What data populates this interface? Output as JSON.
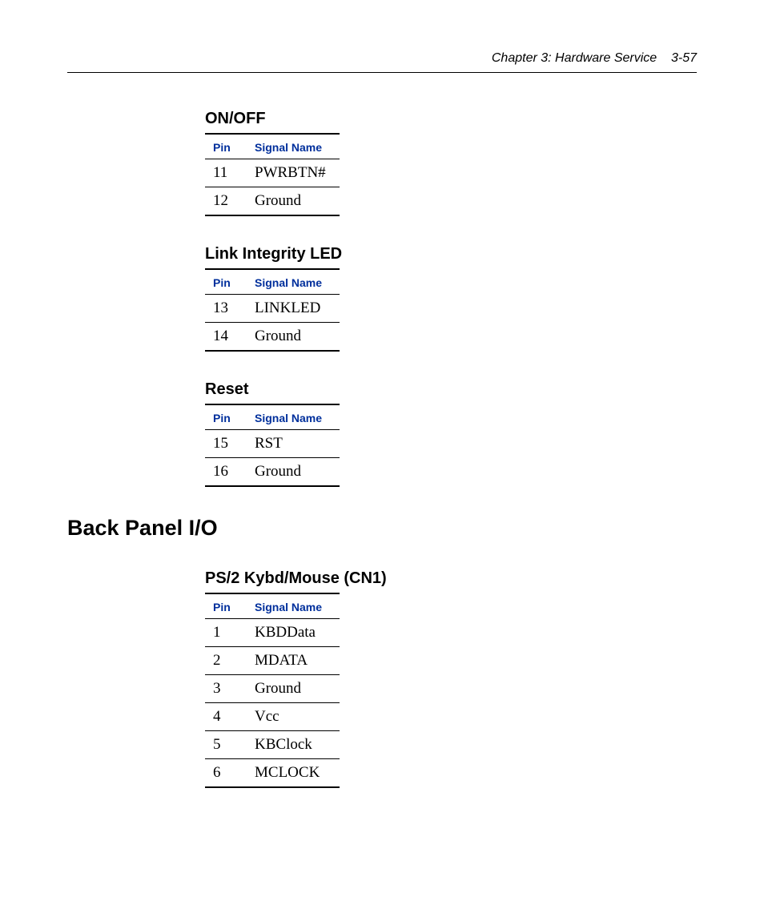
{
  "header": {
    "chapter": "Chapter 3:  Hardware Service",
    "page": "3-57"
  },
  "columns": {
    "pin": "Pin",
    "signal": "Signal Name"
  },
  "tables": [
    {
      "title": "ON/OFF",
      "rows": [
        {
          "pin": "11",
          "signal": "PWRBTN#"
        },
        {
          "pin": "12",
          "signal": "Ground"
        }
      ]
    },
    {
      "title": "Link Integrity LED",
      "rows": [
        {
          "pin": "13",
          "signal": "LINKLED"
        },
        {
          "pin": "14",
          "signal": "Ground"
        }
      ]
    },
    {
      "title": "Reset",
      "rows": [
        {
          "pin": "15",
          "signal": "RST"
        },
        {
          "pin": "16",
          "signal": "Ground"
        }
      ]
    }
  ],
  "section": {
    "title": "Back Panel I/O"
  },
  "tables2": [
    {
      "title": "PS/2 Kybd/Mouse (CN1)",
      "rows": [
        {
          "pin": "1",
          "signal": "KBDData"
        },
        {
          "pin": "2",
          "signal": "MDATA"
        },
        {
          "pin": "3",
          "signal": "Ground"
        },
        {
          "pin": "4",
          "signal": "Vcc"
        },
        {
          "pin": "5",
          "signal": "KBClock"
        },
        {
          "pin": "6",
          "signal": "MCLOCK"
        }
      ]
    }
  ]
}
